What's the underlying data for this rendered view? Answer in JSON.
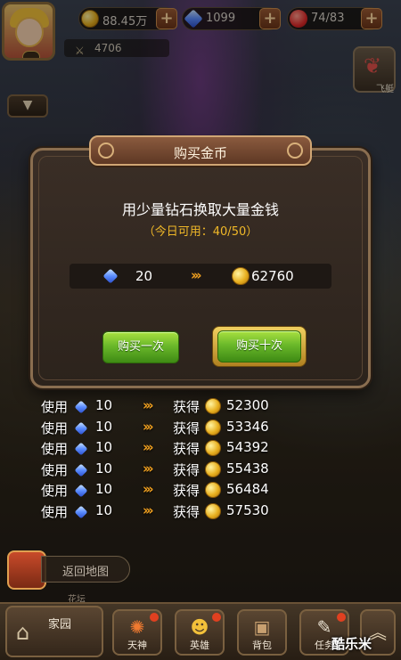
{
  "top": {
    "gold": "88.45万",
    "diamonds": "1099",
    "stamina": "74/83",
    "plus": "+",
    "power": "4706",
    "fly_label": "飞艇"
  },
  "dialog": {
    "title": "购买金币",
    "headline": "用少量钻石换取大量金钱",
    "daily": "（今日可用：40/50）",
    "cost": "20",
    "arrows": "›››",
    "gain": "62760",
    "buy_once": "购买一次",
    "buy_ten": "购买十次"
  },
  "history": {
    "use": "使用",
    "get": "获得",
    "arrows": "›››",
    "rows": [
      {
        "cost": "10",
        "amount": "52300"
      },
      {
        "cost": "10",
        "amount": "53346"
      },
      {
        "cost": "10",
        "amount": "54392"
      },
      {
        "cost": "10",
        "amount": "55438"
      },
      {
        "cost": "10",
        "amount": "56484"
      },
      {
        "cost": "10",
        "amount": "57530"
      }
    ]
  },
  "bottom": {
    "back_map": "返回地图",
    "under_text": "花坛",
    "home": "家园",
    "nav": [
      "天神",
      "英雄",
      "背包",
      "任务"
    ],
    "up": "︽"
  },
  "watermark": "酷乐米",
  "colors": {
    "gold_text": "#f0b828",
    "button_green": "#6ab82a",
    "arrow_orange": "#f0a020"
  }
}
